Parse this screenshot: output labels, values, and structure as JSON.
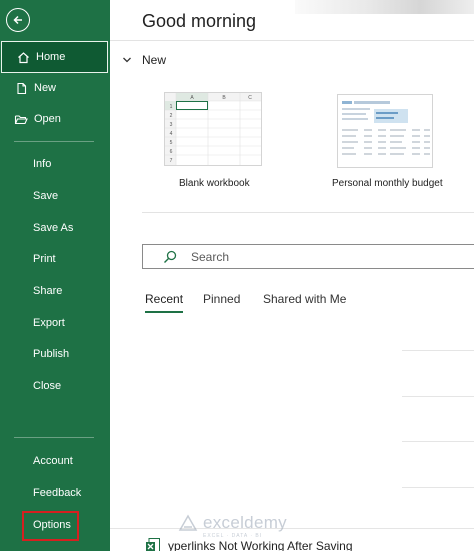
{
  "sidebar": {
    "back_icon": "back-arrow-icon",
    "primary": [
      {
        "label": "Home",
        "icon": "home-icon",
        "active": true
      },
      {
        "label": "New",
        "icon": "new-document-icon"
      },
      {
        "label": "Open",
        "icon": "open-folder-icon"
      }
    ],
    "secondary": [
      "Info",
      "Save",
      "Save As",
      "Print",
      "Share",
      "Export",
      "Publish",
      "Close"
    ],
    "bottom": [
      "Account",
      "Feedback",
      "Options"
    ],
    "highlighted_item": "Options",
    "colors": {
      "background": "#1e7145",
      "active": "#0f5a33",
      "highlight_box": "#d62020"
    }
  },
  "main": {
    "greeting": "Good morning",
    "new_section": {
      "heading": "New",
      "templates": [
        {
          "caption": "Blank workbook",
          "thumbnail": "blank-workbook-thumbnail",
          "columns": [
            "A",
            "B",
            "C"
          ],
          "rows": [
            "1",
            "2",
            "3",
            "4",
            "5",
            "6",
            "7"
          ]
        },
        {
          "caption": "Personal monthly budget",
          "thumbnail": "monthly-budget-thumbnail"
        }
      ]
    },
    "search": {
      "placeholder": "Search",
      "icon": "search-icon"
    },
    "tabs": [
      {
        "label": "Recent",
        "active": true
      },
      {
        "label": "Pinned"
      },
      {
        "label": "Shared with Me"
      }
    ],
    "recent_files": [
      {
        "name": "yperlinks Not Working After Saving",
        "icon": "excel-file-icon"
      }
    ]
  },
  "watermark": {
    "name": "exceldemy",
    "tagline": "EXCEL · DATA · BI"
  }
}
